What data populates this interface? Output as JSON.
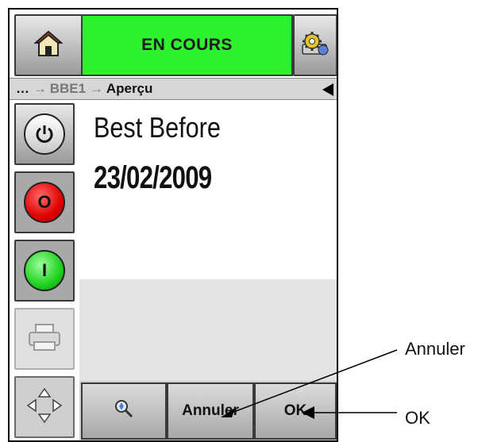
{
  "header": {
    "status": "EN COURS",
    "status_color": "#2cf12c",
    "home_icon": "home-icon",
    "settings_icon": "settings-gear-icon"
  },
  "breadcrumb": {
    "prefix": "…",
    "items": [
      "BBE1",
      "Aperçu"
    ],
    "back_icon": "back-arrow-icon"
  },
  "sidebar": {
    "buttons": [
      {
        "name": "power",
        "icon": "power-icon"
      },
      {
        "name": "stop",
        "icon": "stop-icon",
        "label": "O",
        "color": "#e00000"
      },
      {
        "name": "start",
        "icon": "start-icon",
        "label": "I",
        "color": "#1fd11f"
      },
      {
        "name": "print",
        "icon": "printer-icon"
      },
      {
        "name": "navigation",
        "icon": "direction-arrows-icon"
      }
    ]
  },
  "preview": {
    "line1": "Best Before",
    "line2": "23/02/2009"
  },
  "bottom_bar": {
    "zoom_icon": "zoom-icon",
    "cancel_label": "Annuler",
    "ok_label": "OK"
  },
  "callouts": {
    "annuler": "Annuler",
    "ok": "OK"
  }
}
